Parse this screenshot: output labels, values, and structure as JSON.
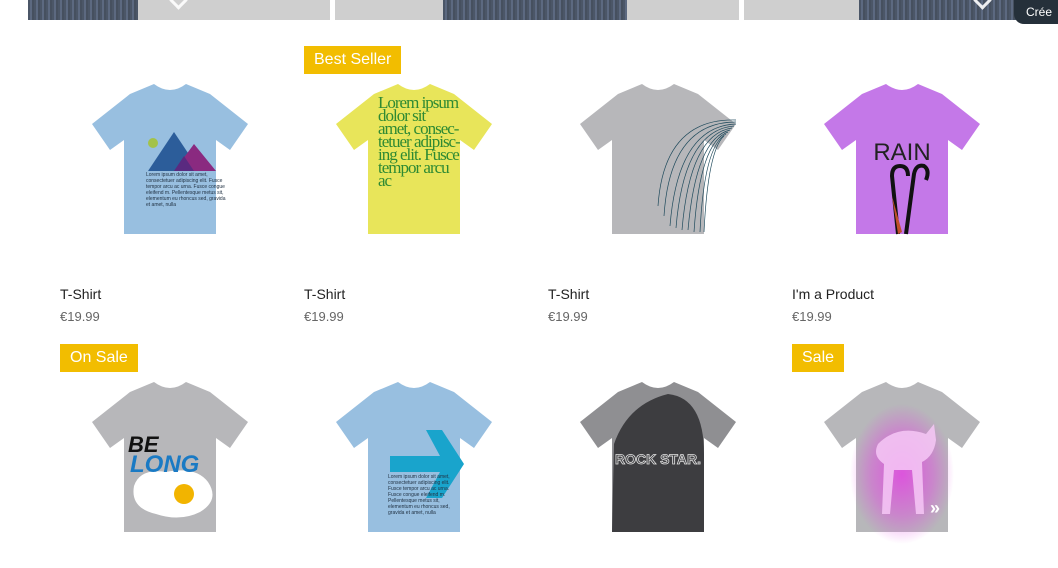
{
  "top_badge": "Crée",
  "products_row1": [
    {
      "title": "T-Shirt",
      "price": "€19.99",
      "ribbon": "",
      "shirt": "blue-mountain"
    },
    {
      "title": "T-Shirt",
      "price": "€19.99",
      "ribbon": "Best Seller",
      "shirt": "yellow-lorem"
    },
    {
      "title": "T-Shirt",
      "price": "€19.99",
      "ribbon": "",
      "shirt": "grey-lines"
    },
    {
      "title": "I'm a Product",
      "price": "€19.99",
      "ribbon": "",
      "shirt": "purple-rain"
    }
  ],
  "products_row2": [
    {
      "ribbon": "On Sale",
      "shirt": "grey-belong"
    },
    {
      "ribbon": "",
      "shirt": "blue-arrow"
    },
    {
      "ribbon": "",
      "shirt": "grey-rock"
    },
    {
      "ribbon": "Sale",
      "shirt": "grey-dog"
    }
  ],
  "shirt_texts": {
    "lorem_small": "Lorem ipsum dolor sit amet, consectetuer adipiscing elit. Fusce tempor arcu ac urna. Fusce congue eleifend m. Pellentesque metus sit, elementum eu rhoncus sed, gravida et amet, nulla",
    "lorem_big": "Lorem ipsum dolor sit amet, consec-tetuer adipisc-ing elit. Fusce tempor arcu ac",
    "rain": "RAIN",
    "belong_1": "BE",
    "belong_2": "LONG",
    "rock": "ROCK STAR."
  },
  "colors": {
    "ribbon": "#f2bd00",
    "shirt_blue": "#98bfe0",
    "shirt_yellow": "#e8e55a",
    "shirt_grey": "#b7b7ba",
    "shirt_purple": "#c478e8",
    "badge_bg": "#25303a"
  }
}
